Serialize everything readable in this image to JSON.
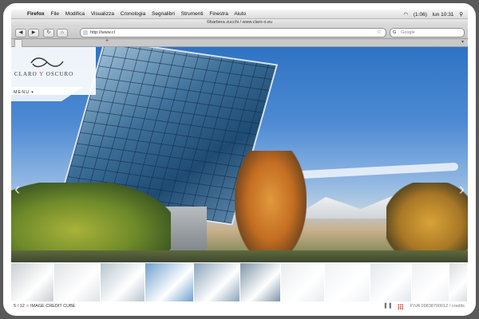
{
  "menubar": {
    "apple": "",
    "app": "Firefox",
    "items": [
      "File",
      "Modifica",
      "Visualizza",
      "Cronologia",
      "Segnalibri",
      "Strumenti",
      "Finestra",
      "Aiuto"
    ],
    "battery": "(1:06)",
    "clock": "lun 10:31"
  },
  "window": {
    "title": "©barbera zucchi / www.claro-o.eu"
  },
  "toolbar": {
    "back": "◀",
    "forward": "▶",
    "reload": "↻",
    "home": "⌂",
    "url": "http://www.cl",
    "search_placeholder": "Google",
    "search_engine_glyph": "G"
  },
  "tabs": {
    "new_tab": "+",
    "list_icon": "▾"
  },
  "site": {
    "logo_text_1": "CLARO",
    "logo_text_y": "Y",
    "logo_text_2": "OSCURO",
    "menu": "MENU",
    "menu_caret": "▾",
    "prev_arrow": "‹",
    "next_arrow": "›"
  },
  "thumbnails": {
    "count": 11,
    "colors": [
      "#c9cdd2",
      "#dfe3e6",
      "#b8c4cf",
      "#6f9fcf",
      "#8aa3b8",
      "#7e94a8",
      "#e9ecee",
      "#f0f2f4",
      "#e2e7ee",
      "#eef0f2",
      "#d9dde0"
    ]
  },
  "footer": {
    "counter": "5 / 12",
    "caption_marker": ">",
    "caption": "IMAGE CREDIT CUBE",
    "pause": "❚❚",
    "piva": "P.IVA 09838700012 / credits"
  },
  "colors": {
    "accent": "#c0392b",
    "sky": "#3e7fcc"
  }
}
